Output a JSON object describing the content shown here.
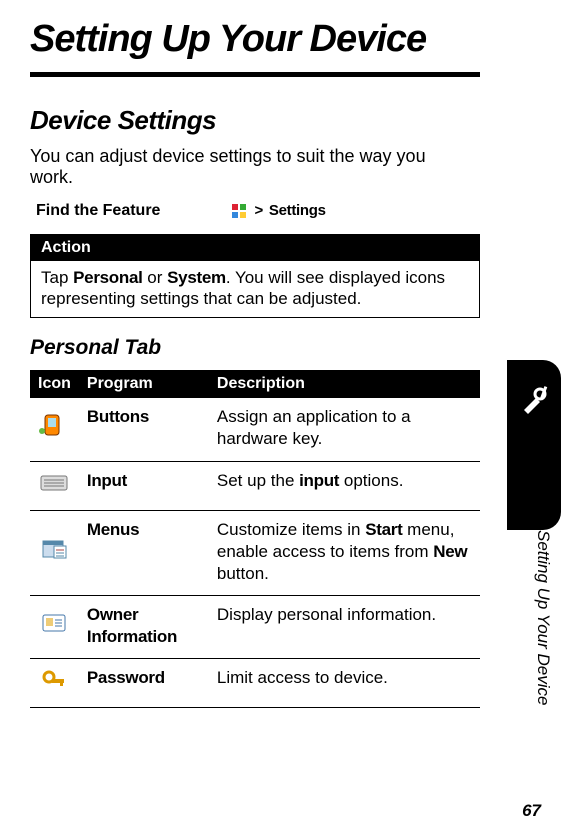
{
  "chapter_title": "Setting Up Your Device",
  "section_title": "Device Settings",
  "intro_text": "You can adjust device settings to suit the way you work.",
  "find_feature_label": "Find the Feature",
  "find_feature_gt": ">",
  "find_feature_target": "Settings",
  "action": {
    "header": "Action",
    "pre": "Tap ",
    "opt1": "Personal",
    "or": " or ",
    "opt2": "System",
    "post": ". You will see displayed icons representing settings that can be adjusted."
  },
  "subsection_title": "Personal Tab",
  "table": {
    "headers": {
      "icon": "Icon",
      "program": "Program",
      "description": "Description"
    },
    "rows": [
      {
        "program": "Buttons",
        "desc_pre": "Assign an application to a hardware key.",
        "desc_bold1": "",
        "desc_mid": "",
        "desc_bold2": "",
        "desc_post": ""
      },
      {
        "program": "Input",
        "desc_pre": "Set up the ",
        "desc_bold1": "input",
        "desc_mid": " options.",
        "desc_bold2": "",
        "desc_post": ""
      },
      {
        "program": "Menus",
        "desc_pre": "Customize items in ",
        "desc_bold1": "Start",
        "desc_mid": " menu, enable access to items from ",
        "desc_bold2": "New",
        "desc_post": " button."
      },
      {
        "program": "Owner Information",
        "desc_pre": "Display personal information.",
        "desc_bold1": "",
        "desc_mid": "",
        "desc_bold2": "",
        "desc_post": ""
      },
      {
        "program": "Password",
        "desc_pre": "Limit access to device.",
        "desc_bold1": "",
        "desc_mid": "",
        "desc_bold2": "",
        "desc_post": ""
      }
    ]
  },
  "side_caption": "Setting Up Your Device",
  "page_number": "67"
}
